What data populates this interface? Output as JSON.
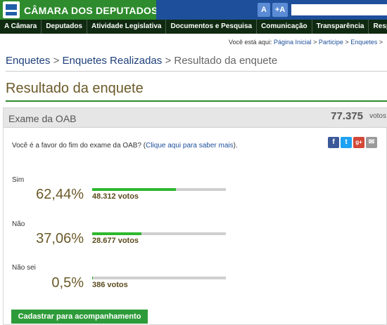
{
  "site": {
    "title": "CÂMARA DOS DEPUTADOS"
  },
  "toolbar": {
    "font_smaller": "A",
    "font_larger": "+A"
  },
  "nav": {
    "items": [
      "A Câmara",
      "Deputados",
      "Atividade Legislativa",
      "Documentos e Pesquisa",
      "Comunicação",
      "Transparência",
      "Respor"
    ]
  },
  "location": {
    "prefix": "Você está aqui:",
    "items": [
      "Página Inicial",
      "Participe",
      "Enquetes"
    ],
    "sep": ">"
  },
  "breadcrumb": {
    "items": [
      "Enquetes",
      "Enquetes Realizadas"
    ],
    "current": "Resultado da enquete",
    "sep": ">"
  },
  "page": {
    "title": "Resultado da enquete"
  },
  "poll": {
    "name": "Exame da OAB",
    "total_votes": "77.375",
    "total_label": "votos",
    "question": "Você é a favor do fim do exame da OAB?",
    "question_link": "Clique aqui para saber mais",
    "options": [
      {
        "label": "Sim",
        "percent": "62,44%",
        "votes": "48.312 votos",
        "fraction": 0.6244
      },
      {
        "label": "Não",
        "percent": "37,06%",
        "votes": "28.677 votos",
        "fraction": 0.3706
      },
      {
        "label": "Não sei",
        "percent": "0,5%",
        "votes": "386 votos",
        "fraction": 0.005
      }
    ],
    "signup_label": "Cadastrar para acompanhamento"
  },
  "share": {
    "icons": [
      "facebook-icon",
      "twitter-icon",
      "google-plus-icon",
      "email-icon"
    ]
  },
  "colors": {
    "header_green": "#2e8b2e",
    "nav_dark": "#0f2a10",
    "bar_fill": "#2eb82e",
    "title_brown": "#6b5a28"
  }
}
